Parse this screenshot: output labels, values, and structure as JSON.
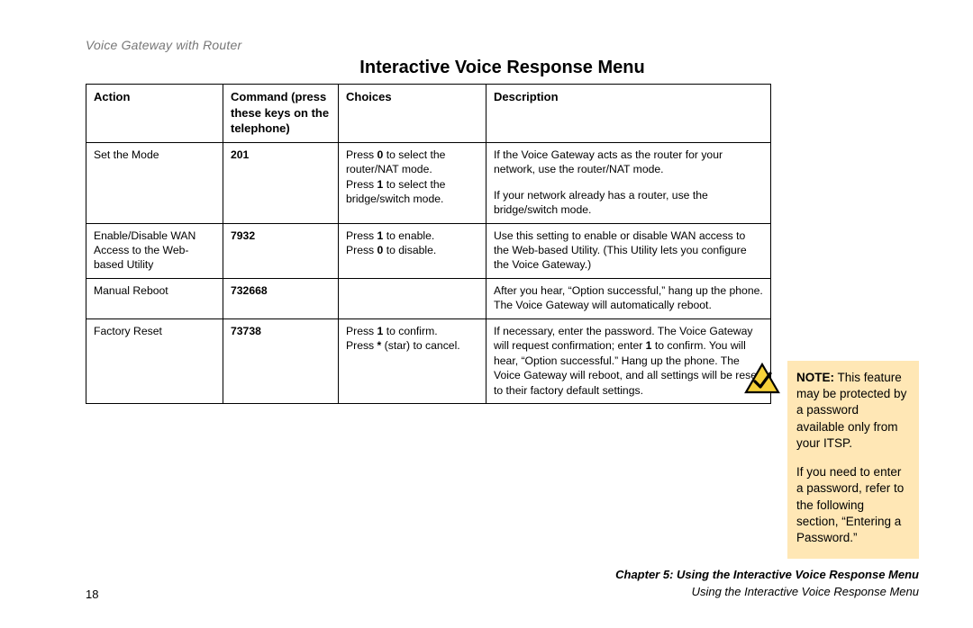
{
  "header": "Voice Gateway with Router",
  "title": "Interactive Voice Response Menu",
  "columns": {
    "action": "Action",
    "command": "Command (press these keys on the telephone)",
    "choices": "Choices",
    "description": "Description"
  },
  "rows": [
    {
      "action": "Set the Mode",
      "command": "201",
      "choices_a": "Press ",
      "choices_b0": "0",
      "choices_c": " to select the router/NAT mode.",
      "choices_d": "Press ",
      "choices_b1": "1",
      "choices_e": " to select the bridge/switch mode.",
      "desc1": "If the Voice Gateway acts as the router for your network, use the router/NAT mode.",
      "desc2": "If your network already has a router, use the bridge/switch mode."
    },
    {
      "action": "Enable/Disable WAN Access to the Web-based Utility",
      "command": "7932",
      "choices_a": "Press ",
      "choices_b1": "1",
      "choices_c": " to enable.",
      "choices_d": "Press ",
      "choices_b0": "0",
      "choices_e": " to disable.",
      "desc1": "Use this setting to enable or disable WAN access to the Web-based Utility. (This Utility lets you configure the Voice Gateway.)"
    },
    {
      "action": "Manual Reboot",
      "command": "732668",
      "choices_plain": "",
      "desc1": "After you hear, “Option successful,” hang up the phone. The Voice Gateway will automatically reboot."
    },
    {
      "action": "Factory Reset",
      "command": "73738",
      "choices_a": "Press ",
      "choices_b1": "1",
      "choices_c": " to confirm.",
      "choices_d": "Press ",
      "choices_bs": "*",
      "choices_e": " (star) to cancel.",
      "desc_a": "If necessary, enter the password. The Voice Gateway will request confirmation; enter ",
      "desc_b1": "1",
      "desc_c": " to confirm. You will hear, “Option successful.” Hang up the phone. The Voice Gateway will reboot, and all settings will be reset to their factory default settings."
    }
  ],
  "note": {
    "label": "NOTE:",
    "body1": "  This feature may be protected by a password available only from your ITSP.",
    "body2": "If you need to enter a password, refer to the following section, “Entering a Password.”"
  },
  "footer": {
    "page": "18",
    "chapter": "Chapter 5: Using the Interactive Voice Response Menu",
    "section": "Using the Interactive Voice Response Menu"
  }
}
